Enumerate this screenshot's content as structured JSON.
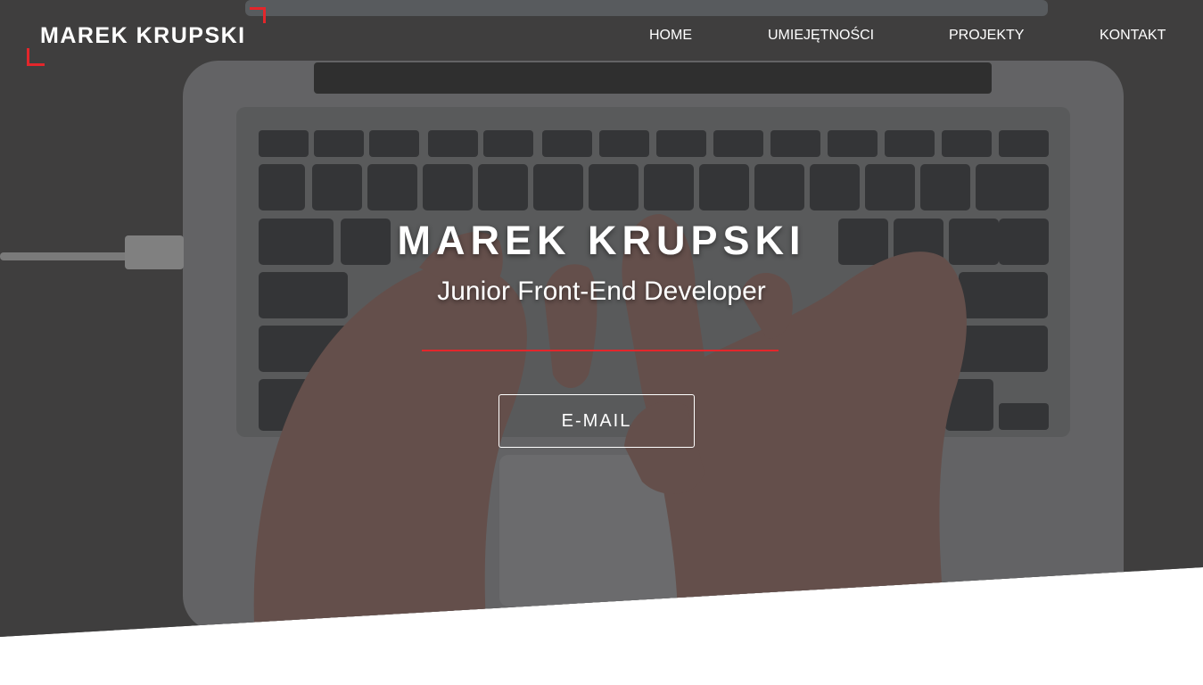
{
  "header": {
    "logo_text": "MAREK KRUPSKI"
  },
  "nav": {
    "items": [
      {
        "label": "HOME"
      },
      {
        "label": "UMIEJĘTNOŚCI"
      },
      {
        "label": "PROJEKTY"
      },
      {
        "label": "KONTAKT"
      }
    ]
  },
  "hero": {
    "name": "MAREK KRUPSKI",
    "subtitle": "Junior Front-End Developer",
    "button_label": "E-MAIL"
  },
  "colors": {
    "accent": "#e3262b",
    "hero_background": "#4a4949",
    "text": "#ffffff",
    "page_background": "#ffffff"
  }
}
